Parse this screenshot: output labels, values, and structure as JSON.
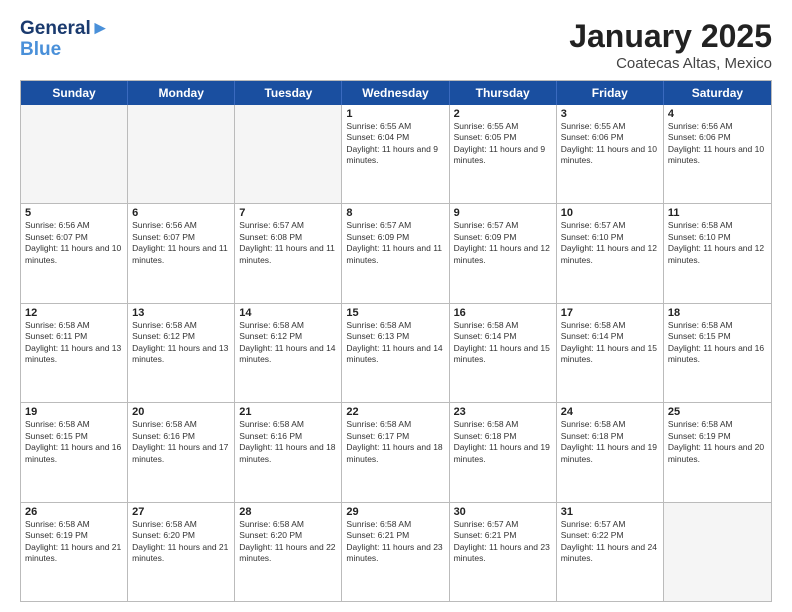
{
  "header": {
    "logo_line1": "General",
    "logo_line2": "Blue",
    "title": "January 2025",
    "subtitle": "Coatecas Altas, Mexico"
  },
  "days_of_week": [
    "Sunday",
    "Monday",
    "Tuesday",
    "Wednesday",
    "Thursday",
    "Friday",
    "Saturday"
  ],
  "weeks": [
    [
      {
        "day": "",
        "text": ""
      },
      {
        "day": "",
        "text": ""
      },
      {
        "day": "",
        "text": ""
      },
      {
        "day": "1",
        "text": "Sunrise: 6:55 AM\nSunset: 6:04 PM\nDaylight: 11 hours and 9 minutes."
      },
      {
        "day": "2",
        "text": "Sunrise: 6:55 AM\nSunset: 6:05 PM\nDaylight: 11 hours and 9 minutes."
      },
      {
        "day": "3",
        "text": "Sunrise: 6:55 AM\nSunset: 6:06 PM\nDaylight: 11 hours and 10 minutes."
      },
      {
        "day": "4",
        "text": "Sunrise: 6:56 AM\nSunset: 6:06 PM\nDaylight: 11 hours and 10 minutes."
      }
    ],
    [
      {
        "day": "5",
        "text": "Sunrise: 6:56 AM\nSunset: 6:07 PM\nDaylight: 11 hours and 10 minutes."
      },
      {
        "day": "6",
        "text": "Sunrise: 6:56 AM\nSunset: 6:07 PM\nDaylight: 11 hours and 11 minutes."
      },
      {
        "day": "7",
        "text": "Sunrise: 6:57 AM\nSunset: 6:08 PM\nDaylight: 11 hours and 11 minutes."
      },
      {
        "day": "8",
        "text": "Sunrise: 6:57 AM\nSunset: 6:09 PM\nDaylight: 11 hours and 11 minutes."
      },
      {
        "day": "9",
        "text": "Sunrise: 6:57 AM\nSunset: 6:09 PM\nDaylight: 11 hours and 12 minutes."
      },
      {
        "day": "10",
        "text": "Sunrise: 6:57 AM\nSunset: 6:10 PM\nDaylight: 11 hours and 12 minutes."
      },
      {
        "day": "11",
        "text": "Sunrise: 6:58 AM\nSunset: 6:10 PM\nDaylight: 11 hours and 12 minutes."
      }
    ],
    [
      {
        "day": "12",
        "text": "Sunrise: 6:58 AM\nSunset: 6:11 PM\nDaylight: 11 hours and 13 minutes."
      },
      {
        "day": "13",
        "text": "Sunrise: 6:58 AM\nSunset: 6:12 PM\nDaylight: 11 hours and 13 minutes."
      },
      {
        "day": "14",
        "text": "Sunrise: 6:58 AM\nSunset: 6:12 PM\nDaylight: 11 hours and 14 minutes."
      },
      {
        "day": "15",
        "text": "Sunrise: 6:58 AM\nSunset: 6:13 PM\nDaylight: 11 hours and 14 minutes."
      },
      {
        "day": "16",
        "text": "Sunrise: 6:58 AM\nSunset: 6:14 PM\nDaylight: 11 hours and 15 minutes."
      },
      {
        "day": "17",
        "text": "Sunrise: 6:58 AM\nSunset: 6:14 PM\nDaylight: 11 hours and 15 minutes."
      },
      {
        "day": "18",
        "text": "Sunrise: 6:58 AM\nSunset: 6:15 PM\nDaylight: 11 hours and 16 minutes."
      }
    ],
    [
      {
        "day": "19",
        "text": "Sunrise: 6:58 AM\nSunset: 6:15 PM\nDaylight: 11 hours and 16 minutes."
      },
      {
        "day": "20",
        "text": "Sunrise: 6:58 AM\nSunset: 6:16 PM\nDaylight: 11 hours and 17 minutes."
      },
      {
        "day": "21",
        "text": "Sunrise: 6:58 AM\nSunset: 6:16 PM\nDaylight: 11 hours and 18 minutes."
      },
      {
        "day": "22",
        "text": "Sunrise: 6:58 AM\nSunset: 6:17 PM\nDaylight: 11 hours and 18 minutes."
      },
      {
        "day": "23",
        "text": "Sunrise: 6:58 AM\nSunset: 6:18 PM\nDaylight: 11 hours and 19 minutes."
      },
      {
        "day": "24",
        "text": "Sunrise: 6:58 AM\nSunset: 6:18 PM\nDaylight: 11 hours and 19 minutes."
      },
      {
        "day": "25",
        "text": "Sunrise: 6:58 AM\nSunset: 6:19 PM\nDaylight: 11 hours and 20 minutes."
      }
    ],
    [
      {
        "day": "26",
        "text": "Sunrise: 6:58 AM\nSunset: 6:19 PM\nDaylight: 11 hours and 21 minutes."
      },
      {
        "day": "27",
        "text": "Sunrise: 6:58 AM\nSunset: 6:20 PM\nDaylight: 11 hours and 21 minutes."
      },
      {
        "day": "28",
        "text": "Sunrise: 6:58 AM\nSunset: 6:20 PM\nDaylight: 11 hours and 22 minutes."
      },
      {
        "day": "29",
        "text": "Sunrise: 6:58 AM\nSunset: 6:21 PM\nDaylight: 11 hours and 23 minutes."
      },
      {
        "day": "30",
        "text": "Sunrise: 6:57 AM\nSunset: 6:21 PM\nDaylight: 11 hours and 23 minutes."
      },
      {
        "day": "31",
        "text": "Sunrise: 6:57 AM\nSunset: 6:22 PM\nDaylight: 11 hours and 24 minutes."
      },
      {
        "day": "",
        "text": ""
      }
    ]
  ]
}
